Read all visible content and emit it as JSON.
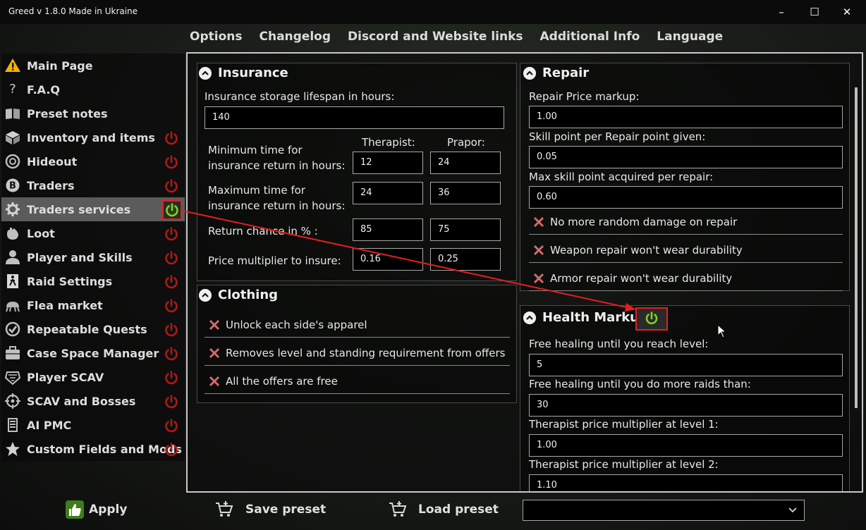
{
  "window": {
    "title": "Greed v 1.8.0 Made in Ukraine",
    "minimize": "–",
    "maximize": "☐",
    "close": "✕"
  },
  "topnav": [
    "Options",
    "Changelog",
    "Discord and Website links",
    "Additional Info",
    "Language"
  ],
  "sidebar": {
    "items": [
      {
        "label": "Main Page",
        "icon": "warning-icon"
      },
      {
        "label": "F.A.Q",
        "icon": "question-icon"
      },
      {
        "label": "Preset notes",
        "icon": "book-icon"
      },
      {
        "label": "Inventory and items",
        "icon": "box-icon"
      },
      {
        "label": "Hideout",
        "icon": "hideout-icon"
      },
      {
        "label": "Traders",
        "icon": "bitcoin-icon"
      },
      {
        "label": "Traders services",
        "icon": "gear-icon"
      },
      {
        "label": "Loot",
        "icon": "hand-icon"
      },
      {
        "label": "Player and Skills",
        "icon": "person-icon"
      },
      {
        "label": "Raid Settings",
        "icon": "exit-icon"
      },
      {
        "label": "Flea market",
        "icon": "flea-icon"
      },
      {
        "label": "Repeatable Quests",
        "icon": "check-badge-icon"
      },
      {
        "label": "Case Space Manager",
        "icon": "briefcase-icon"
      },
      {
        "label": "Player SCAV",
        "icon": "scav-icon"
      },
      {
        "label": "SCAV and Bosses",
        "icon": "crosshair-icon"
      },
      {
        "label": "AI PMC",
        "icon": "pmc-icon"
      },
      {
        "label": "Custom Fields and Mods",
        "icon": "star-icon"
      }
    ]
  },
  "insurance": {
    "title": "Insurance",
    "storage_label": "Insurance storage lifespan in hours:",
    "storage_value": "140",
    "col_therapist": "Therapist:",
    "col_prapor": "Prapor:",
    "min_label": "Minimum time for insurance return in hours:",
    "min_therapist": "12",
    "min_prapor": "24",
    "max_label": "Maximum time for insurance return in hours:",
    "max_therapist": "24",
    "max_prapor": "36",
    "return_label": "Return chance in % :",
    "return_therapist": "85",
    "return_prapor": "75",
    "price_label": "Price multiplier to insure:",
    "price_therapist": "0.16",
    "price_prapor": "0.25"
  },
  "clothing": {
    "title": "Clothing",
    "options": [
      "Unlock each side's apparel",
      "Removes level and standing requirement from offers",
      "All the offers are free"
    ]
  },
  "repair": {
    "title": "Repair",
    "markup_label": "Repair Price markup:",
    "markup_value": "1.00",
    "skill_label": "Skill point per Repair point given:",
    "skill_value": "0.05",
    "max_label": "Max skill point acquired per repair:",
    "max_value": "0.60",
    "options": [
      "No more random damage on repair",
      "Weapon repair won't wear durability",
      "Armor repair won't wear durability"
    ]
  },
  "health": {
    "title": "Health Markup",
    "free_level_label": "Free healing until you reach level:",
    "free_level_value": "5",
    "free_raids_label": "Free healing until you do more raids than:",
    "free_raids_value": "30",
    "level1_label": "Therapist price multiplier at level 1:",
    "level1_value": "1.00",
    "level2_label": "Therapist price multiplier at level 2:",
    "level2_value": "1.10"
  },
  "bottom": {
    "apply": "Apply",
    "save": "Save preset",
    "load": "Load preset",
    "preset_value": ""
  },
  "colors": {
    "power_off": "#b01818",
    "power_on": "#7ed321",
    "annotation": "#e41e1e"
  }
}
